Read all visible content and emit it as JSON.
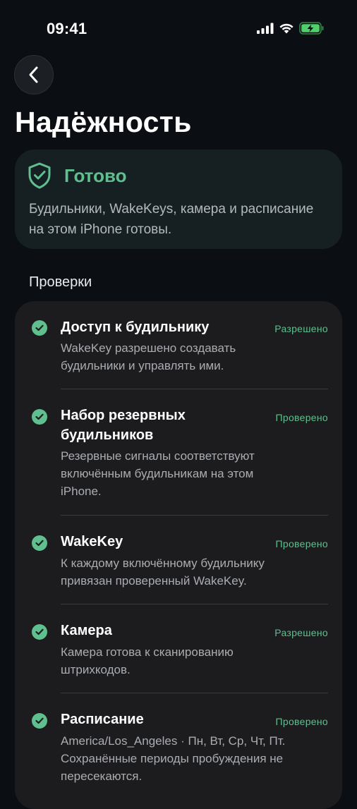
{
  "status_bar": {
    "time": "09:41",
    "icons": [
      "signal-icon",
      "wifi-icon",
      "battery-charging-icon"
    ]
  },
  "navigation": {
    "back_icon": "chevron-left-icon"
  },
  "page": {
    "title": "Надёжность"
  },
  "status_card": {
    "icon": "shield-check-icon",
    "title": "Готово",
    "description": "Будильники, WakeKeys, камера и расписание на этом iPhone готовы."
  },
  "checks": {
    "section_title": "Проверки",
    "items": [
      {
        "title": "Доступ к будильнику",
        "status": "Разрешено",
        "description": "WakeKey разрешено создавать будильники и управлять ими."
      },
      {
        "title": "Набор резервных будильников",
        "status": "Проверено",
        "description": "Резервные сигналы соответствуют включённым будильникам на этом iPhone."
      },
      {
        "title": "WakeKey",
        "status": "Проверено",
        "description": "К каждому включённому будильнику привязан проверенный WakeKey."
      },
      {
        "title": "Камера",
        "status": "Разрешено",
        "description": "Камера готова к сканированию штрихкодов."
      },
      {
        "title": "Расписание",
        "status": "Проверено",
        "description": "America/Los_Angeles · Пн, Вт, Ср, Чт, Пт. Сохранённые периоды пробуждения не пересекаются."
      }
    ]
  },
  "colors": {
    "background": "#0b0f14",
    "accent": "#5fbf8e",
    "card": "#1c1c1f",
    "status_card": "#162023"
  }
}
